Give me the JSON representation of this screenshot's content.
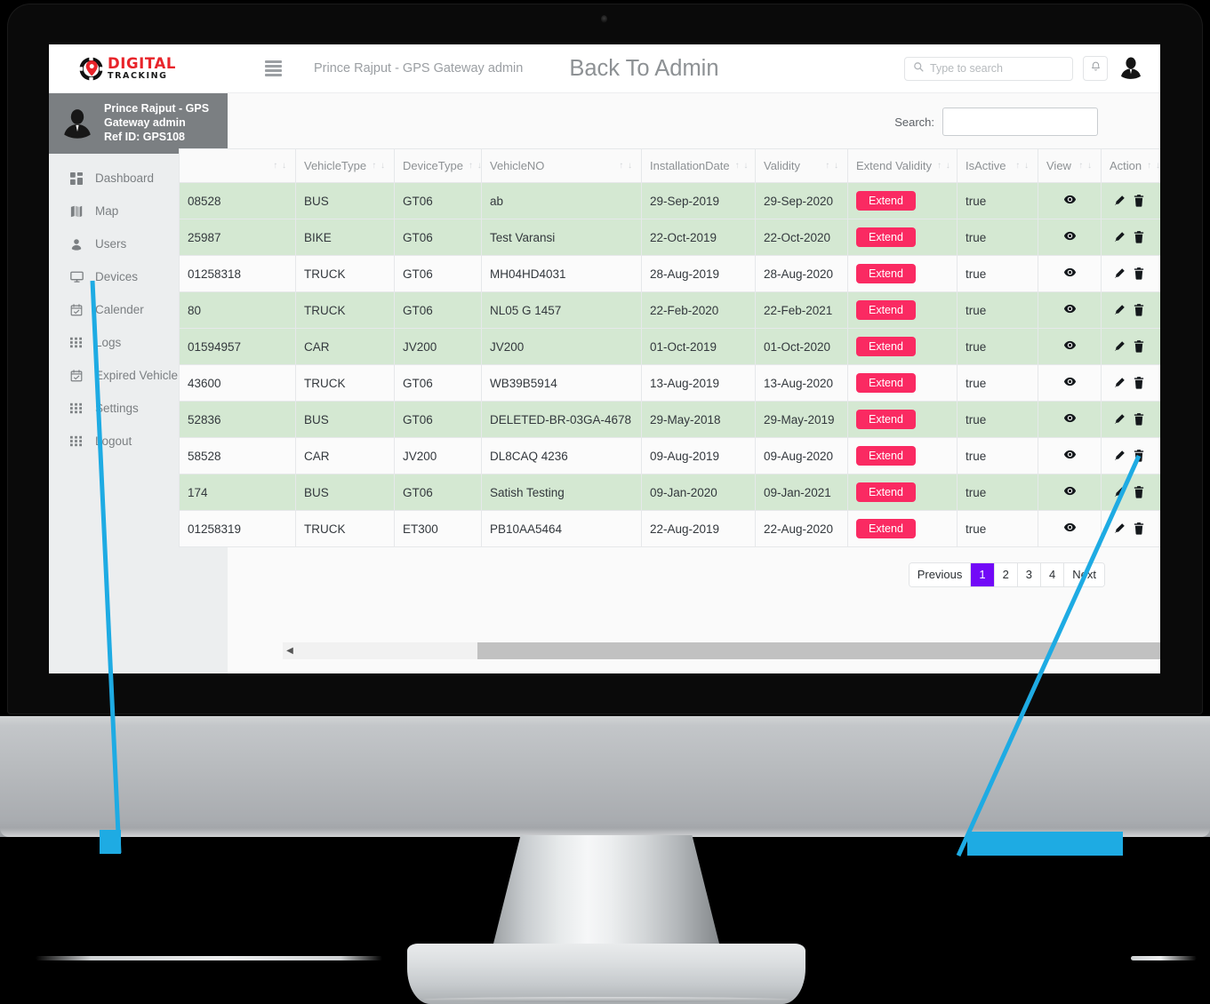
{
  "brand": {
    "logo_primary": "DIGITAL",
    "logo_secondary": "TRACKING",
    "logo_icon": "gps-pin-logo-icon"
  },
  "navbar": {
    "menu_toggle_icon": "hamburger-icon",
    "user_label": "Prince Rajput - GPS Gateway admin",
    "page_title": "Back To Admin",
    "search_placeholder": "Type to search",
    "search_value": "",
    "search_icon": "search-icon",
    "bell_icon": "bell-icon",
    "avatar_icon": "user-avatar-icon"
  },
  "sidebar": {
    "profile": {
      "name": "Prince Rajput - GPS Gateway admin",
      "ref": "Ref ID: GPS108",
      "avatar_icon": "user-avatar-icon"
    },
    "items": [
      {
        "label": "Dashboard",
        "icon": "dashboard-grid-icon",
        "has_caret": false
      },
      {
        "label": "Map",
        "icon": "map-icon",
        "has_caret": false
      },
      {
        "label": "Users",
        "icon": "user-circle-icon",
        "has_caret": false
      },
      {
        "label": "Devices",
        "icon": "monitor-icon",
        "has_caret": false
      },
      {
        "label": "Calender",
        "icon": "calendar-icon",
        "has_caret": false
      },
      {
        "label": "Logs",
        "icon": "grid-dots-icon",
        "has_caret": false
      },
      {
        "label": "Expired Vehicle",
        "icon": "calendar-icon",
        "has_caret": false
      },
      {
        "label": "Settings",
        "icon": "grid-dots-icon",
        "has_caret": true,
        "caret": "›"
      },
      {
        "label": "Logout",
        "icon": "grid-dots-icon",
        "has_caret": false
      }
    ]
  },
  "table_toolbar": {
    "search_label": "Search:",
    "search_value": "",
    "search_placeholder": ""
  },
  "table": {
    "columns": [
      {
        "label": "",
        "sortable": true,
        "key": "imei"
      },
      {
        "label": "VehicleType",
        "sortable": true,
        "key": "vehicle_type"
      },
      {
        "label": "DeviceType",
        "sortable": true,
        "key": "device_type"
      },
      {
        "label": "VehicleNO",
        "sortable": true,
        "key": "vehicle_no"
      },
      {
        "label": "InstallationDate",
        "sortable": true,
        "key": "installation_date"
      },
      {
        "label": "Validity",
        "sortable": true,
        "key": "validity"
      },
      {
        "label": "Extend Validity",
        "sortable": true,
        "key": "extend"
      },
      {
        "label": "IsActive",
        "sortable": true,
        "key": "is_active"
      },
      {
        "label": "View",
        "sortable": true,
        "key": "view"
      },
      {
        "label": "Action",
        "sortable": true,
        "key": "action"
      }
    ],
    "sort_icons": "↑ ↓",
    "extend_button_label": "Extend",
    "view_icon": "eye-icon",
    "edit_icon": "pencil-icon",
    "delete_icon": "trash-icon",
    "rows": [
      {
        "stripe": "green",
        "imei": "08528",
        "vehicle_type": "BUS",
        "device_type": "GT06",
        "vehicle_no": "ab",
        "installation_date": "29-Sep-2019",
        "validity": "29-Sep-2020",
        "is_active": "true"
      },
      {
        "stripe": "green",
        "imei": "25987",
        "vehicle_type": "BIKE",
        "device_type": "GT06",
        "vehicle_no": "Test Varansi",
        "installation_date": "22-Oct-2019",
        "validity": "22-Oct-2020",
        "is_active": "true"
      },
      {
        "stripe": "white",
        "imei": "01258318",
        "vehicle_type": "TRUCK",
        "device_type": "GT06",
        "vehicle_no": "MH04HD4031",
        "installation_date": "28-Aug-2019",
        "validity": "28-Aug-2020",
        "is_active": "true"
      },
      {
        "stripe": "green",
        "imei": "80",
        "vehicle_type": "TRUCK",
        "device_type": "GT06",
        "vehicle_no": "NL05 G 1457",
        "installation_date": "22-Feb-2020",
        "validity": "22-Feb-2021",
        "is_active": "true"
      },
      {
        "stripe": "green",
        "imei": "01594957",
        "vehicle_type": "CAR",
        "device_type": "JV200",
        "vehicle_no": "JV200",
        "installation_date": "01-Oct-2019",
        "validity": "01-Oct-2020",
        "is_active": "true"
      },
      {
        "stripe": "white",
        "imei": "43600",
        "vehicle_type": "TRUCK",
        "device_type": "GT06",
        "vehicle_no": "WB39B5914",
        "installation_date": "13-Aug-2019",
        "validity": "13-Aug-2020",
        "is_active": "true"
      },
      {
        "stripe": "green",
        "imei": "52836",
        "vehicle_type": "BUS",
        "device_type": "GT06",
        "vehicle_no": "DELETED-BR-03GA-4678",
        "installation_date": "29-May-2018",
        "validity": "29-May-2019",
        "is_active": "true"
      },
      {
        "stripe": "white",
        "imei": "58528",
        "vehicle_type": "CAR",
        "device_type": "JV200",
        "vehicle_no": "DL8CAQ 4236",
        "installation_date": "09-Aug-2019",
        "validity": "09-Aug-2020",
        "is_active": "true"
      },
      {
        "stripe": "green",
        "imei": "174",
        "vehicle_type": "BUS",
        "device_type": "GT06",
        "vehicle_no": "Satish Testing",
        "installation_date": "09-Jan-2020",
        "validity": "09-Jan-2021",
        "is_active": "true"
      },
      {
        "stripe": "white",
        "imei": "01258319",
        "vehicle_type": "TRUCK",
        "device_type": "ET300",
        "vehicle_no": "PB10AA5464",
        "installation_date": "22-Aug-2019",
        "validity": "22-Aug-2020",
        "is_active": "true"
      }
    ]
  },
  "pagination": {
    "previous_label": "Previous",
    "next_label": "Next",
    "pages": [
      "1",
      "2",
      "3",
      "4"
    ],
    "active_page": "1"
  },
  "scrollbar": {
    "left_arrow_icon": "scroll-left-arrow-icon"
  },
  "colors": {
    "accent_purple": "#7209f7",
    "extend_pink": "#fa2a62",
    "row_green": "#d4e8d2",
    "annotation_blue": "#1eabe3",
    "brand_red": "#e8242a",
    "sidebar_bg": "#eceeef",
    "profile_bg": "#7b7f82"
  }
}
